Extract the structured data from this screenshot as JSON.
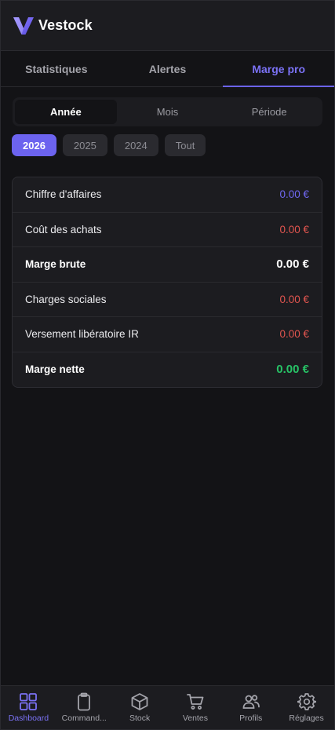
{
  "header": {
    "brand": "Vestock",
    "logo_icon": "vestock-logo-icon",
    "accent": "#6c63ef"
  },
  "tabs": [
    {
      "label": "Statistiques",
      "active": false
    },
    {
      "label": "Alertes",
      "active": false
    },
    {
      "label": "Marge pro",
      "active": true
    }
  ],
  "period_segments": [
    {
      "label": "Année",
      "active": true
    },
    {
      "label": "Mois",
      "active": false
    },
    {
      "label": "Période",
      "active": false
    }
  ],
  "years": [
    {
      "label": "2026",
      "active": true
    },
    {
      "label": "2025",
      "active": false
    },
    {
      "label": "2024",
      "active": false
    },
    {
      "label": "Tout",
      "active": false
    }
  ],
  "margin_table": [
    {
      "label": "Chiffre d'affaires",
      "value": "0.00 €",
      "color": "#7068f2",
      "bold": false
    },
    {
      "label": "Coût des achats",
      "value": "0.00 €",
      "color": "#e2554f",
      "bold": false
    },
    {
      "label": "Marge brute",
      "value": "0.00 €",
      "color": "#ffffff",
      "bold": true
    },
    {
      "label": "Charges sociales",
      "value": "0.00 €",
      "color": "#e2554f",
      "bold": false
    },
    {
      "label": "Versement libératoire IR",
      "value": "0.00 €",
      "color": "#e2554f",
      "bold": false
    },
    {
      "label": "Marge nette",
      "value": "0.00 €",
      "color": "#27c266",
      "bold": true
    }
  ],
  "bottom_nav": [
    {
      "label": "Dashboard",
      "icon": "grid-icon",
      "active": true
    },
    {
      "label": "Command...",
      "icon": "clipboard-icon",
      "active": false
    },
    {
      "label": "Stock",
      "icon": "box-icon",
      "active": false
    },
    {
      "label": "Ventes",
      "icon": "cart-icon",
      "active": false
    },
    {
      "label": "Profils",
      "icon": "users-icon",
      "active": false
    },
    {
      "label": "Réglages",
      "icon": "gear-icon",
      "active": false
    }
  ]
}
